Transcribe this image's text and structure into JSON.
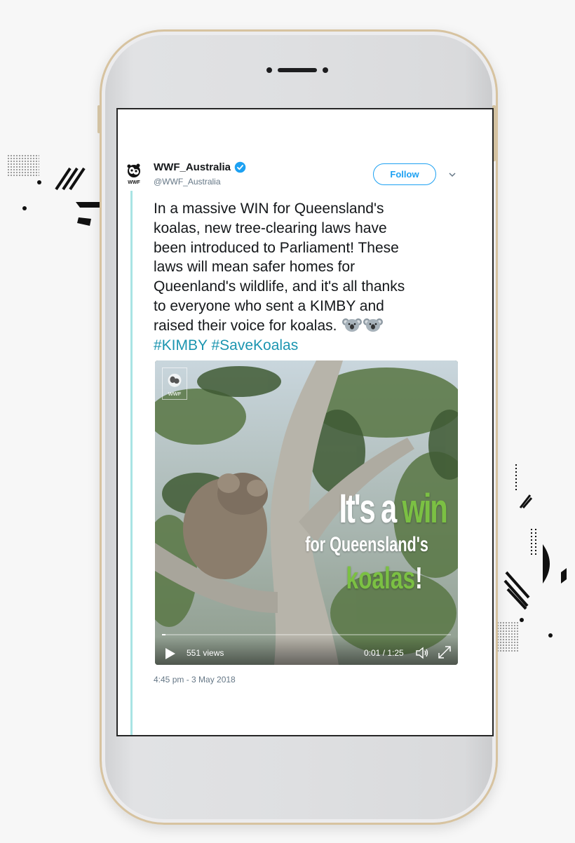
{
  "tweet": {
    "display_name": "WWF_Australia",
    "handle": "@WWF_Australia",
    "verified_icon": "verified-badge-icon",
    "follow_label": "Follow",
    "text_lines": [
      "In a massive WIN for Queensland's",
      "koalas, new tree-clearing laws have",
      "been introduced to Parliament! These",
      "laws will mean safer homes for",
      "Queenland's wildlife, and it's all thanks",
      "to everyone who sent a KIMBY and",
      "raised their voice for koalas."
    ],
    "emoji": [
      "koala-emoji",
      "koala-emoji"
    ],
    "hashtags": "#KIMBY #SaveKoalas",
    "timestamp": "4:45 pm - 3 May 2018"
  },
  "media": {
    "overlay_line1_a": "It's a ",
    "overlay_line1_b": "win",
    "overlay_line2": "for Queensland's",
    "overlay_line3_a": "koalas",
    "overlay_line3_b": "!",
    "views": "551 views",
    "time": "0:01 / 1:25",
    "progress": 0.012
  },
  "colors": {
    "link": "#1da1f2",
    "hashtag": "#1b95b0",
    "thread_line": "#a9e4e4",
    "overlay_green": "#7bc043"
  }
}
